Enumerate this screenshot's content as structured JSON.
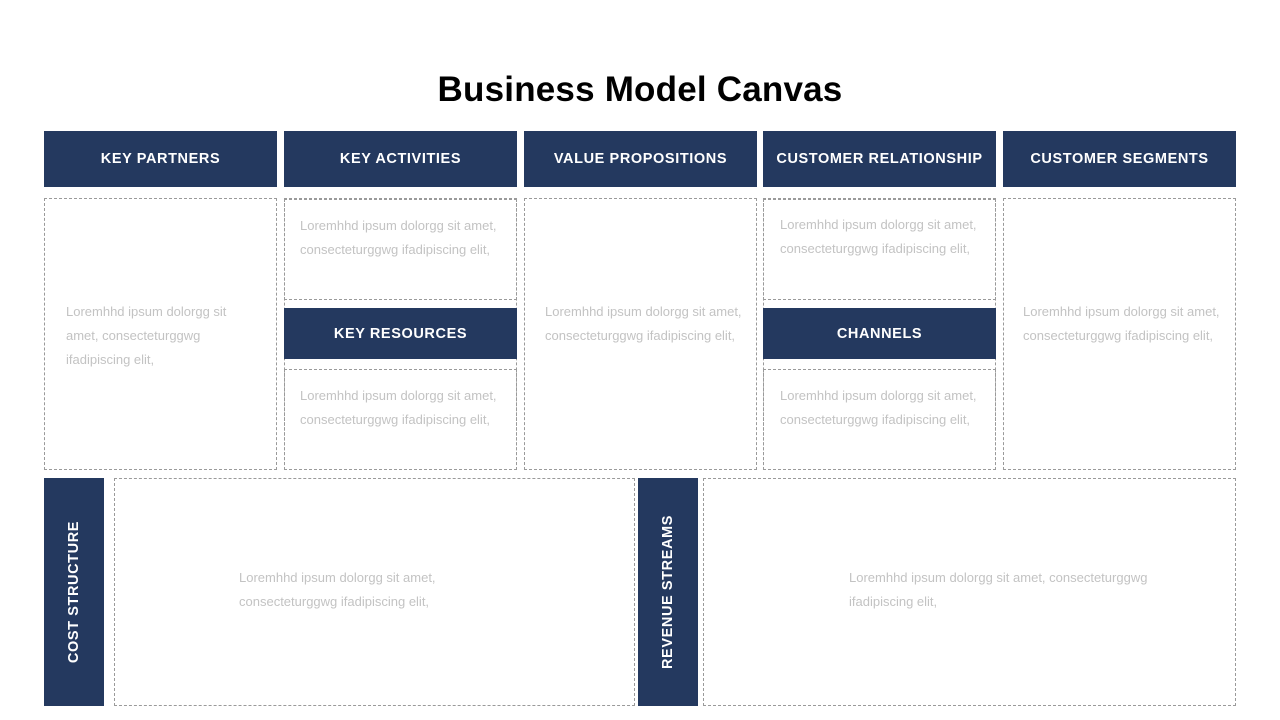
{
  "title": "Business Model Canvas",
  "accent_color": "#24395F",
  "body_text_color": "#c3c3c3",
  "dashed_border_color": "#9a9a9a",
  "lorem_short": "Loremhhd ipsum dolorgg sit amet, consecteturggwg ifadipiscing  elit,",
  "lorem_wide": "Loremhhd ipsum dolorgg sit amet, consecteturggwg  ifadipiscing  elit,",
  "columns": {
    "key_partners": {
      "header": "KEY PARTNERS",
      "body": "Loremhhd ipsum dolorgg sit amet, consecteturggwg ifadipiscing  elit,"
    },
    "key_activities": {
      "header": "KEY ACTIVITIES",
      "body": "Loremhhd ipsum dolorgg sit amet, consecteturggwg ifadipiscing  elit,"
    },
    "key_resources": {
      "header": "KEY RESOURCES",
      "body": "Loremhhd ipsum dolorgg sit amet, consecteturggwg ifadipiscing  elit,"
    },
    "value_propositions": {
      "header": "VALUE PROPOSITIONS",
      "body": "Loremhhd ipsum dolorgg sit amet, consecteturggwg ifadipiscing  elit,"
    },
    "customer_relationship": {
      "header": "CUSTOMER RELATIONSHIP",
      "body": "Loremhhd ipsum dolorgg sit amet, consecteturggwg ifadipiscing  elit,"
    },
    "channels": {
      "header": "CHANNELS",
      "body": "Loremhhd ipsum dolorgg sit amet, consecteturggwg ifadipiscing  elit,"
    },
    "customer_segments": {
      "header": "CUSTOMER SEGMENTS",
      "body": "Loremhhd ipsum dolorgg sit amet, consecteturggwg ifadipiscing  elit,"
    },
    "cost_structure": {
      "header": "COST STRUCTURE",
      "body": "Loremhhd ipsum dolorgg sit amet, consecteturggwg  ifadipiscing  elit,"
    },
    "revenue_streams": {
      "header": "REVENUE STREAMS",
      "body": "Loremhhd ipsum dolorgg sit amet, consecteturggwg  ifadipiscing  elit,"
    }
  }
}
